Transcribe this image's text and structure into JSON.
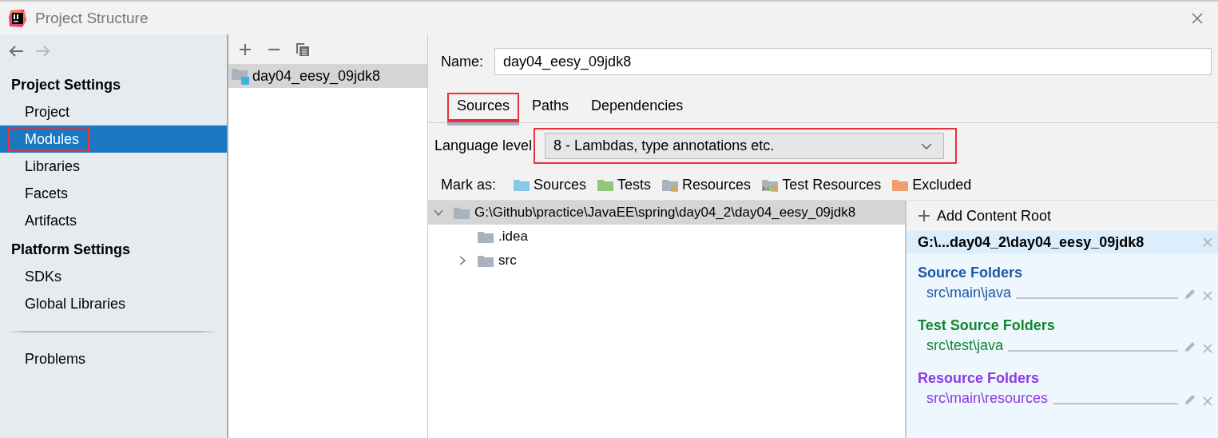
{
  "window": {
    "title": "Project Structure"
  },
  "navigation": [
    {
      "kind": "back",
      "disabled": false
    },
    {
      "kind": "forward",
      "disabled": true
    }
  ],
  "sidebar": {
    "sections": [
      {
        "heading": "Project Settings",
        "items": [
          {
            "label": "Project",
            "selected": false,
            "highlighted": false
          },
          {
            "label": "Modules",
            "selected": true,
            "highlighted": true
          },
          {
            "label": "Libraries",
            "selected": false,
            "highlighted": false
          },
          {
            "label": "Facets",
            "selected": false,
            "highlighted": false
          },
          {
            "label": "Artifacts",
            "selected": false,
            "highlighted": false
          }
        ]
      },
      {
        "heading": "Platform Settings",
        "items": [
          {
            "label": "SDKs",
            "selected": false,
            "highlighted": false
          },
          {
            "label": "Global Libraries",
            "selected": false,
            "highlighted": false
          }
        ]
      },
      {
        "items": [
          {
            "label": "Problems",
            "selected": false,
            "highlighted": false
          }
        ]
      }
    ]
  },
  "modules": {
    "toolbar": [
      {
        "kind": "add"
      },
      {
        "kind": "remove"
      },
      {
        "kind": "copy"
      }
    ],
    "items": [
      {
        "label": "day04_eesy_09jdk8",
        "selected": true
      }
    ]
  },
  "name_field": {
    "label": "Name:",
    "value": "day04_eesy_09jdk8"
  },
  "tabs": [
    {
      "label": "Sources",
      "selected": true,
      "highlighted": true
    },
    {
      "label": "Paths",
      "selected": false,
      "highlighted": false
    },
    {
      "label": "Dependencies",
      "selected": false,
      "highlighted": false
    }
  ],
  "language_level": {
    "label": "Language level",
    "value": "8 - Lambdas, type annotations etc.",
    "highlighted": true
  },
  "mark_as": {
    "label": "Mark as:",
    "buttons": [
      {
        "kind": "sources",
        "label": "Sources"
      },
      {
        "kind": "tests",
        "label": "Tests"
      },
      {
        "kind": "resources",
        "label": "Resources"
      },
      {
        "kind": "test_resources",
        "label": "Test Resources"
      },
      {
        "kind": "excluded",
        "label": "Excluded"
      }
    ]
  },
  "tree": [
    {
      "label": "G:\\Github\\practice\\JavaEE\\spring\\day04_2\\day04_eesy_09jdk8",
      "expanded": true,
      "selected": true,
      "children": [
        {
          "label": ".idea",
          "selected": false
        },
        {
          "label": "src",
          "expanded": false,
          "selected": false
        }
      ]
    }
  ],
  "content_roots": {
    "add_label": "Add Content Root",
    "roots": [
      {
        "path": "G:\\...day04_2\\day04_eesy_09jdk8",
        "selected": true,
        "groups": [
          {
            "title": "Source Folders",
            "color": "#1b5aa6",
            "folders": [
              "src\\main\\java"
            ]
          },
          {
            "title": "Test Source Folders",
            "color": "#12872f",
            "folders": [
              "src\\test\\java"
            ]
          },
          {
            "title": "Resource Folders",
            "color": "#8a3ae6",
            "folders": [
              "src\\main\\resources"
            ]
          }
        ]
      }
    ]
  }
}
